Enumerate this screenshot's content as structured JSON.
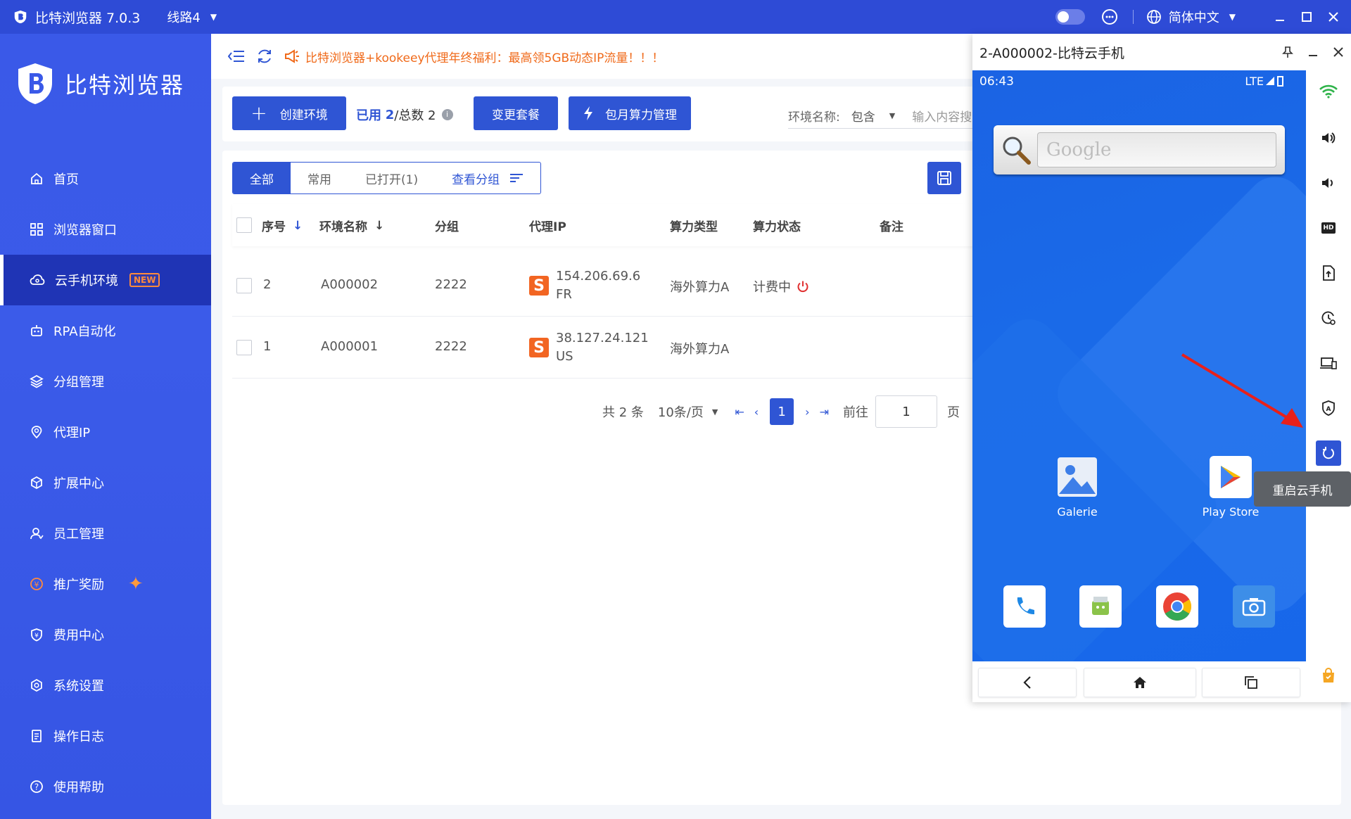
{
  "titlebar": {
    "app_title": "比特浏览器 7.0.3",
    "route": "线路4",
    "language": "简体中文"
  },
  "sidebar": {
    "brand": "比特浏览器",
    "items": [
      {
        "label": "首页",
        "icon": "home-icon"
      },
      {
        "label": "浏览器窗口",
        "icon": "grid-icon"
      },
      {
        "label": "云手机环境",
        "icon": "cloud-icon",
        "badge": "NEW",
        "active": true
      },
      {
        "label": "RPA自动化",
        "icon": "robot-icon"
      },
      {
        "label": "分组管理",
        "icon": "layers-icon"
      },
      {
        "label": "代理IP",
        "icon": "location-icon"
      },
      {
        "label": "扩展中心",
        "icon": "cube-icon"
      },
      {
        "label": "员工管理",
        "icon": "user-icon"
      },
      {
        "label": "推广奖励",
        "icon": "reward-icon"
      },
      {
        "label": "费用中心",
        "icon": "shield-yen-icon"
      },
      {
        "label": "系统设置",
        "icon": "settings-icon"
      },
      {
        "label": "操作日志",
        "icon": "log-icon"
      },
      {
        "label": "使用帮助",
        "icon": "help-icon"
      }
    ]
  },
  "notice": {
    "text": "比特浏览器+kookeey代理年终福利：最高领5GB动态IP流量！！！"
  },
  "toolbar": {
    "create_label": "创建环境",
    "used_label": "已用",
    "used_value": "2",
    "total_label": "/总数 2",
    "change_plan_label": "变更套餐",
    "monthly_label": "包月算力管理",
    "filter_label": "环境名称:",
    "filter_op": "包含",
    "search_placeholder": "输入内容搜"
  },
  "tabs": [
    {
      "label": "全部",
      "active": true
    },
    {
      "label": "常用"
    },
    {
      "label": "已打开(1)"
    },
    {
      "label": "查看分组"
    }
  ],
  "table": {
    "headers": [
      "序号",
      "环境名称",
      "分组",
      "代理IP",
      "算力类型",
      "算力状态",
      "备注"
    ],
    "rows": [
      {
        "seq": "2",
        "name": "A000002",
        "group": "2222",
        "ip": "154.206.69.6",
        "country": "FR",
        "type": "海外算力A",
        "status": "计费中"
      },
      {
        "seq": "1",
        "name": "A000001",
        "group": "2222",
        "ip": "38.127.24.121",
        "country": "US",
        "type": "海外算力A",
        "status": ""
      }
    ]
  },
  "pager": {
    "total": "共 2 条",
    "page_size": "10条/页",
    "current": "1",
    "goto_label": "前往",
    "goto_value": "1",
    "unit": "页"
  },
  "phone": {
    "window_title": "2-A000002-比特云手机",
    "time": "06:43",
    "network": "LTE",
    "search_hint": "Google",
    "apps": [
      {
        "label": "Galerie"
      },
      {
        "label": "Play Store"
      }
    ],
    "tooltip": "重启云手机"
  },
  "colors": {
    "primary": "#2f55d4",
    "sidebar": "#3a59e8",
    "notice": "#f06a1a",
    "badge": "#ff8a3d"
  }
}
